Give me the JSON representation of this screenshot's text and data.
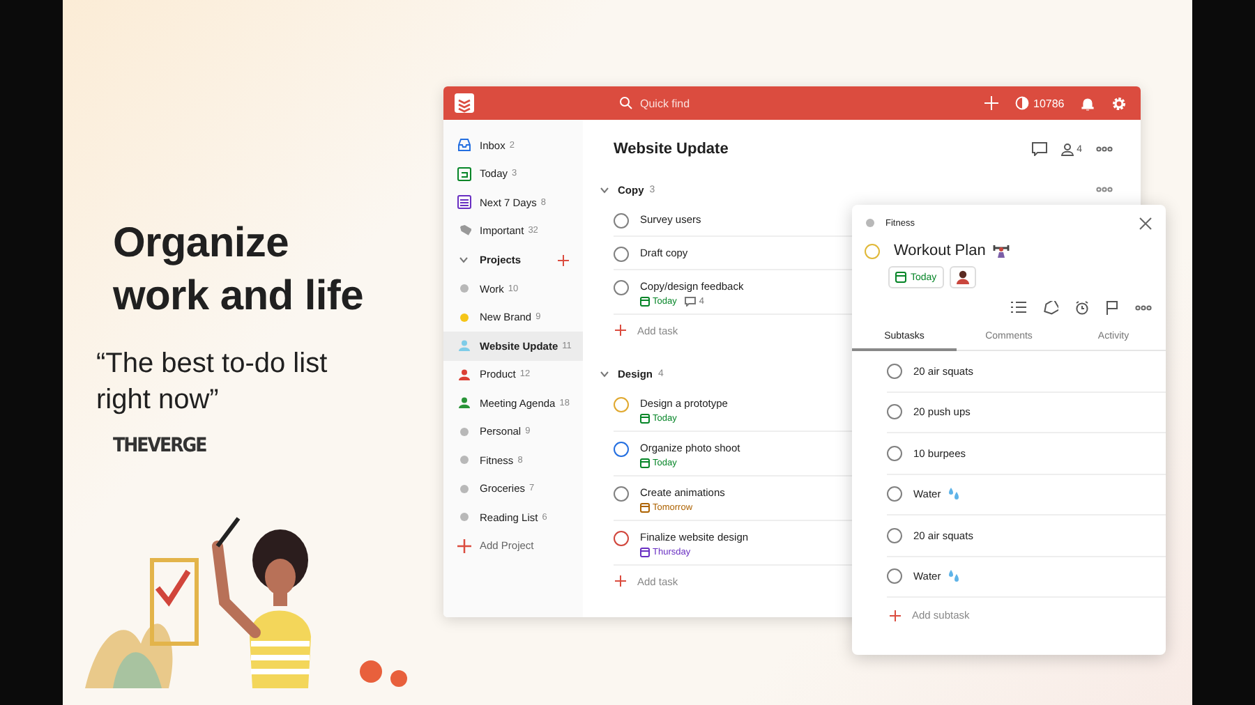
{
  "promo": {
    "headline": "Organize work and life",
    "quote": "“The best to-do list right now”",
    "source": "THEVERGE"
  },
  "topbar": {
    "search": {
      "placeholder": "Quick find"
    },
    "karma": "10786"
  },
  "sidebar": {
    "items": [
      {
        "kind": "inbox",
        "label": "Inbox",
        "count": "2",
        "selected": false
      },
      {
        "kind": "today",
        "label": "Today",
        "count": "3",
        "selected": false
      },
      {
        "kind": "next",
        "label": "Next 7 Days",
        "count": "8",
        "selected": false
      },
      {
        "kind": "filter",
        "label": "Important",
        "count": "32",
        "selected": false
      }
    ],
    "projects_header": "Projects",
    "projects": [
      {
        "kind": "project",
        "label": "Work",
        "count": "10",
        "color": "#b8b8b8",
        "selected": false
      },
      {
        "kind": "project",
        "label": "New Brand",
        "count": "9",
        "color": "#f5c518",
        "selected": false
      },
      {
        "kind": "shared",
        "label": "Website Update",
        "count": "11",
        "color": "#7ecce8",
        "selected": true
      },
      {
        "kind": "shared",
        "label": "Product",
        "count": "12",
        "color": "#db4035",
        "selected": false
      },
      {
        "kind": "shared",
        "label": "Meeting Agenda",
        "count": "18",
        "color": "#299438",
        "selected": false
      },
      {
        "kind": "project",
        "label": "Personal",
        "count": "9",
        "color": "#b8b8b8",
        "selected": false
      },
      {
        "kind": "project",
        "label": "Fitness",
        "count": "8",
        "color": "#b8b8b8",
        "selected": false
      },
      {
        "kind": "project",
        "label": "Groceries",
        "count": "7",
        "color": "#b8b8b8",
        "selected": false
      },
      {
        "kind": "project",
        "label": "Reading List",
        "count": "6",
        "color": "#b8b8b8",
        "selected": false
      }
    ],
    "add_project": "Add Project"
  },
  "main": {
    "title": "Website Update",
    "members": "4",
    "sections": [
      {
        "name": "Copy",
        "count": "3",
        "add_task": "Add task",
        "tasks": [
          {
            "title": "Survey users",
            "color": "#808080"
          },
          {
            "title": "Draft copy",
            "color": "#808080"
          },
          {
            "title": "Copy/design feedback",
            "color": "#808080",
            "due": {
              "label": "Today",
              "color": "#058527"
            },
            "comments": "4"
          }
        ]
      },
      {
        "name": "Design",
        "count": "4",
        "add_task": "Add task",
        "tasks": [
          {
            "title": "Design a prototype",
            "color": "#e0a82e",
            "due": {
              "label": "Today",
              "color": "#058527"
            }
          },
          {
            "title": "Organize photo shoot",
            "color": "#246fe0",
            "due": {
              "label": "Today",
              "color": "#058527"
            }
          },
          {
            "title": "Create animations",
            "color": "#808080",
            "due": {
              "label": "Tomorrow",
              "color": "#ad6200"
            }
          },
          {
            "title": "Finalize website design",
            "color": "#d1453b",
            "due": {
              "label": "Thursday",
              "color": "#692fc2"
            }
          }
        ]
      }
    ]
  },
  "detail": {
    "project": "Fitness",
    "title": "Workout Plan",
    "checked": false,
    "due": "Today",
    "tabs": [
      {
        "label": "Subtasks",
        "selected": true
      },
      {
        "label": "Comments",
        "selected": false
      },
      {
        "label": "Activity",
        "selected": false
      }
    ],
    "subtasks": [
      {
        "title": "20 air squats",
        "water": false,
        "checked": false
      },
      {
        "title": "20 push ups",
        "water": false,
        "checked": false
      },
      {
        "title": "10 burpees",
        "water": false,
        "checked": false
      },
      {
        "title": "Water",
        "water": true,
        "checked": false
      },
      {
        "title": "20 air squats",
        "water": false,
        "checked": false
      },
      {
        "title": "Water",
        "water": true,
        "checked": false
      }
    ],
    "add_subtask": "Add subtask"
  }
}
